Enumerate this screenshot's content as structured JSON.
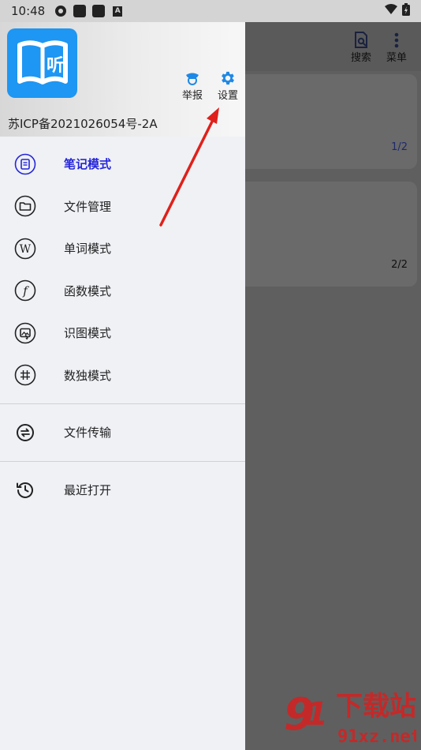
{
  "status_bar": {
    "time": "10:48"
  },
  "background_app": {
    "actions": {
      "search": "搜索",
      "menu": "菜单"
    },
    "cards": [
      {
        "page": "1/2"
      },
      {
        "page": "2/2"
      }
    ]
  },
  "drawer": {
    "header": {
      "logo_char": "听",
      "report_label": "举报",
      "settings_label": "设置",
      "icp": "苏ICP备2021026054号-2A"
    },
    "menu_group1": [
      {
        "label": "笔记模式",
        "icon": "note-icon"
      },
      {
        "label": "文件管理",
        "icon": "folder-icon"
      },
      {
        "label": "单词模式",
        "icon": "word-icon"
      },
      {
        "label": "函数模式",
        "icon": "function-icon"
      },
      {
        "label": "识图模式",
        "icon": "image-recognition-icon"
      },
      {
        "label": "数独模式",
        "icon": "sudoku-icon"
      }
    ],
    "menu_group2": [
      {
        "label": "文件传输",
        "icon": "transfer-icon"
      }
    ],
    "menu_group3": [
      {
        "label": "最近打开",
        "icon": "history-icon"
      }
    ]
  },
  "watermark": {
    "text_cn": "下载站",
    "text_url": "91xz.net"
  },
  "colors": {
    "accent": "#1e96f3",
    "active": "#2626d9",
    "arrow": "#e0201b"
  }
}
